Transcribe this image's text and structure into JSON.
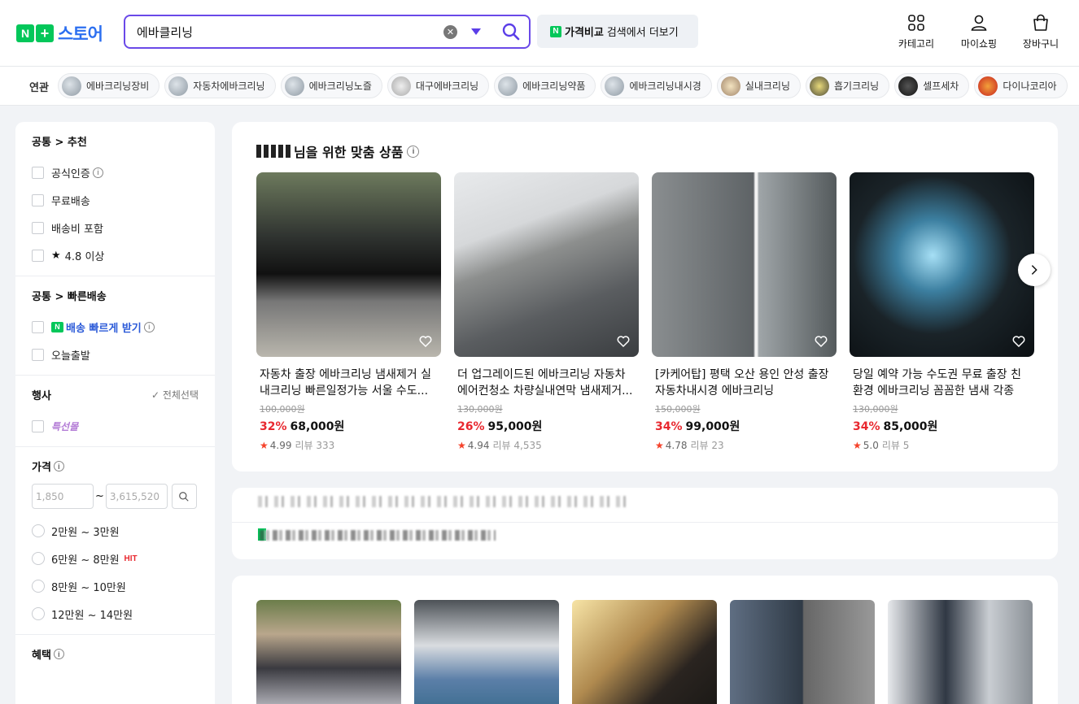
{
  "header": {
    "logo_n": "N",
    "logo_plus": "+",
    "logo_text": "스토어",
    "search_value": "에바클리닝",
    "compare_n": "N",
    "compare_strong": "가격비교",
    "compare_text": "검색에서 더보기",
    "nav": [
      {
        "label": "카테고리",
        "icon": "category-icon"
      },
      {
        "label": "마이쇼핑",
        "icon": "user-icon"
      },
      {
        "label": "장바구니",
        "icon": "cart-icon"
      }
    ]
  },
  "related": {
    "label": "연관",
    "chips": [
      "에바크리닝장비",
      "자동차에바크리닝",
      "에바크리닝노즐",
      "대구에바크리닝",
      "에바크리닝약품",
      "에바크리닝내시경",
      "실내크리닝",
      "흡기크리닝",
      "셀프세차",
      "다이나코리아"
    ]
  },
  "sidebar": {
    "sec1_title": "공통 > 추천",
    "sec1_items": [
      "공식인증",
      "무료배송",
      "배송비 포함",
      "4.8 이상"
    ],
    "star": "★",
    "sec2_title": "공통 > 빠른배송",
    "fast_badge": "N",
    "fast_label": "배송 빠르게 받기",
    "today_label": "오늘출발",
    "event_title": "행사",
    "select_all": "전체선택",
    "event_brand": "특선몰",
    "price_title": "가격",
    "price_min_placeholder": "1,850",
    "price_max_placeholder": "3,615,520",
    "tilde": "~",
    "price_ranges": [
      "2만원 ~ 3만원",
      "6만원 ~ 8만원",
      "8만원 ~ 10만원",
      "12만원 ~ 14만원"
    ],
    "hit": "HIT",
    "benefit_title": "혜택",
    "info": "i"
  },
  "recommend": {
    "title_suffix": "님을 위한 맞춤 상품",
    "products": [
      {
        "title": "자동차 출장 에바크리닝 냄새제거 실내크리닝 빠른일정가능 서울 수도...",
        "original": "100,000원",
        "discount": "32%",
        "price": "68,000원",
        "rating": "4.99",
        "review": "리뷰 333"
      },
      {
        "title": "더 업그레이드된 에바크리닝 자동차 에어컨청소 차량실내연막 냄새제거...",
        "original": "130,000원",
        "discount": "26%",
        "price": "95,000원",
        "rating": "4.94",
        "review": "리뷰 4,535"
      },
      {
        "title": "[카케어탑] 평택 오산 용인 안성 출장 자동차내시경 에바크리닝",
        "original": "150,000원",
        "discount": "34%",
        "price": "99,000원",
        "rating": "4.78",
        "review": "리뷰 23"
      },
      {
        "title": "당일 예약 가능 수도권 무료 출장 친환경 에바크리닝 꼼꼼한 냄새 각종 냄...",
        "original": "130,000원",
        "discount": "34%",
        "price": "85,000원",
        "rating": "5.0",
        "review": "리뷰 5"
      }
    ]
  },
  "colors": {
    "brand_green": "#03c75a",
    "search_border": "#6a49e8",
    "discount_red": "#e8282f",
    "logo_blue": "#2c6ff0"
  }
}
